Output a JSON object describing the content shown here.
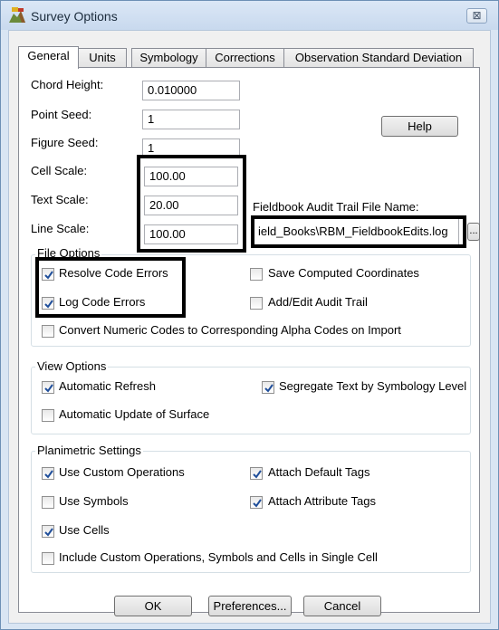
{
  "window": {
    "title": "Survey Options",
    "close_glyph": "⊠"
  },
  "tabs": [
    "General",
    "Units",
    "Symbology",
    "Corrections",
    "Observation Standard Deviation"
  ],
  "general": {
    "chord_height": {
      "label": "Chord Height:",
      "value": "0.010000"
    },
    "point_seed": {
      "label": "Point Seed:",
      "value": "1"
    },
    "figure_seed": {
      "label": "Figure Seed:",
      "value": "1"
    },
    "cell_scale": {
      "label": "Cell Scale:",
      "value": "100.00"
    },
    "text_scale": {
      "label": "Text Scale:",
      "value": "20.00"
    },
    "line_scale": {
      "label": "Line Scale:",
      "value": "100.00"
    },
    "help_button": "Help",
    "fieldbook": {
      "label": "Fieldbook Audit Trail File Name:",
      "value": "ield_Books\\RBM_FieldbookEdits.log",
      "browse": "..."
    }
  },
  "file_options": {
    "title": "File Options",
    "resolve_code_errors": {
      "label": "Resolve Code Errors",
      "checked": true
    },
    "log_code_errors": {
      "label": "Log Code Errors",
      "checked": true
    },
    "save_computed_coordinates": {
      "label": "Save Computed Coordinates",
      "checked": false
    },
    "add_edit_audit_trail": {
      "label": "Add/Edit Audit Trail",
      "checked": false
    },
    "convert_numeric_codes": {
      "label": "Convert Numeric Codes to Corresponding Alpha Codes on Import",
      "checked": false
    }
  },
  "view_options": {
    "title": "View Options",
    "automatic_refresh": {
      "label": "Automatic Refresh",
      "checked": true
    },
    "segregate_text": {
      "label": "Segregate Text by Symbology Level",
      "checked": true
    },
    "automatic_update_surface": {
      "label": "Automatic Update of Surface",
      "checked": false
    }
  },
  "planimetric": {
    "title": "Planimetric Settings",
    "use_custom_operations": {
      "label": "Use Custom Operations",
      "checked": true
    },
    "attach_default_tags": {
      "label": "Attach Default Tags",
      "checked": true
    },
    "use_symbols": {
      "label": "Use Symbols",
      "checked": false
    },
    "attach_attribute_tags": {
      "label": "Attach Attribute Tags",
      "checked": true
    },
    "use_cells": {
      "label": "Use Cells",
      "checked": true
    },
    "include_single_cell": {
      "label": "Include Custom Operations, Symbols and Cells in Single Cell",
      "checked": false
    }
  },
  "footer": {
    "ok": "OK",
    "preferences": "Preferences...",
    "cancel": "Cancel"
  },
  "colors": {
    "check": "#1f4e9a",
    "frame": "#d9e5f3",
    "highlight": "#000000"
  }
}
